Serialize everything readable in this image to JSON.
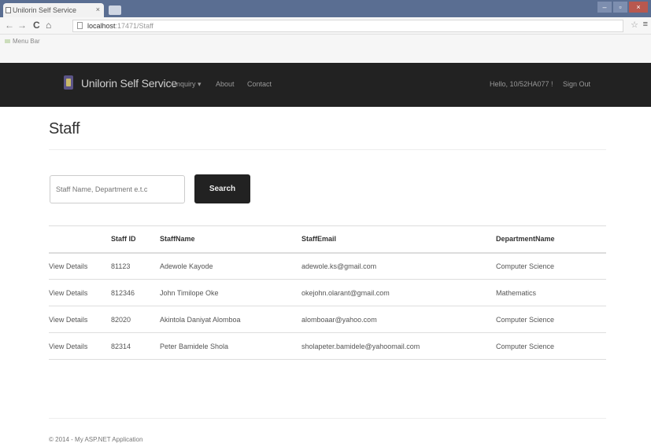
{
  "browser": {
    "tab_title": "Unilorin Self Service",
    "tab_close": "×",
    "window_controls": [
      "–",
      "▫",
      "×"
    ],
    "nav_back": "←",
    "nav_forward": "→",
    "nav_reload": "C",
    "nav_home": "⌂",
    "url_host": "localhost",
    "url_rest": ":17471/Staff",
    "bookmark_folder": "Menu Bar",
    "star": "☆",
    "menu": "≡"
  },
  "navbar": {
    "brand": "Unilorin Self Service",
    "items": [
      "Enquiry ▾",
      "About",
      "Contact"
    ],
    "user_greeting": "Hello, 10/52HA077 !",
    "sign_out": "Sign Out"
  },
  "page": {
    "title": "Staff"
  },
  "search": {
    "placeholder": "Staff Name, Department e.t.c",
    "button_label": "Search"
  },
  "table": {
    "headers": [
      "",
      "Staff ID",
      "StaffName",
      "StaffEmail",
      "DepartmentName"
    ],
    "rows": [
      [
        "View Details",
        "81123",
        "Adewole Kayode",
        "adewole.ks@gmail.com",
        "Computer Science"
      ],
      [
        "View Details",
        "812346",
        "John Timilope Oke",
        "okejohn.olarant@gmail.com",
        "Mathematics"
      ],
      [
        "View Details",
        "82020",
        "Akintola Daniyat Alomboa",
        "alomboaar@yahoo.com",
        "Computer Science"
      ],
      [
        "View Details",
        "82314",
        "Peter Bamidele Shola",
        "sholapeter.bamidele@yahoomail.com",
        "Computer Science"
      ]
    ]
  },
  "footer": {
    "text": "© 2014 - My ASP.NET Application"
  },
  "colors": {
    "navbar_bg": "#222222",
    "browser_frame": "#5a6e92"
  }
}
